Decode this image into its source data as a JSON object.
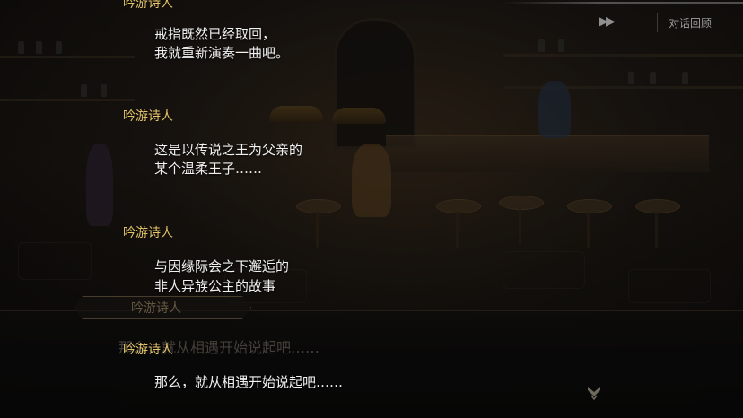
{
  "top_controls": {
    "auto_glyph": "▶▶",
    "auto_icon": "fast-forward-icon",
    "skip_label": "对话回顾"
  },
  "dialogue_log": [
    {
      "speaker": "吟游诗人",
      "lines": [
        "戒指既然已经取回，",
        "我就重新演奏一曲吧。"
      ]
    },
    {
      "speaker": "吟游诗人",
      "lines": [
        "这是以传说之王为父亲的",
        "某个温柔王子……"
      ]
    },
    {
      "speaker": "吟游诗人",
      "lines": [
        "与因缘际会之下邂逅的",
        "非人异族公主的故事"
      ]
    },
    {
      "speaker": "吟游诗人",
      "lines": [
        "那么，就从相遇开始说起吧……"
      ]
    }
  ],
  "background_dialog": {
    "nameplate": "吟游诗人",
    "text": "那么，就从相遇开始说起吧……"
  },
  "advance_icon": "chevron-down-crest-icon",
  "colors": {
    "speaker": "#e3c46a",
    "text": "#f1f1f1",
    "panel": "#080808"
  }
}
